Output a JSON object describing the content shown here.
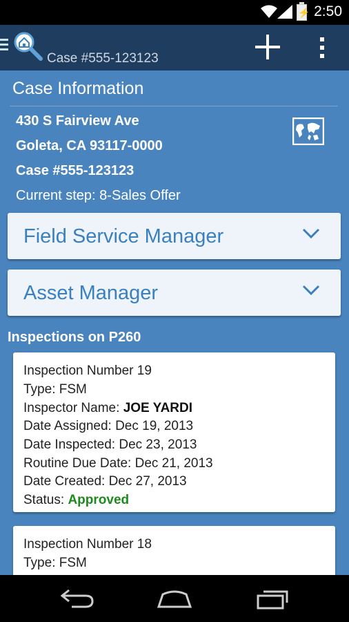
{
  "status_bar": {
    "time": "2:50"
  },
  "action_bar": {
    "title": "Case #555-123123"
  },
  "case_info": {
    "heading": "Case Information",
    "address_line1": "430  S Fairview Ave",
    "address_line2": "Goleta, CA 93117-0000",
    "case_number": "Case #555-123123",
    "current_step": "Current step: 8-Sales Offer"
  },
  "dropdowns": [
    {
      "label": "Field Service Manager"
    },
    {
      "label": "Asset Manager"
    }
  ],
  "inspections": {
    "heading": "Inspections on P260",
    "cards": [
      {
        "number": "Inspection Number 19",
        "type": "Type: FSM",
        "inspector_label": "Inspector Name:",
        "inspector_value": "JOE YARDI",
        "date_assigned": "Date Assigned: Dec 19, 2013",
        "date_inspected": "Date Inspected: Dec 23, 2013",
        "routine_due": "Routine Due Date: Dec 21, 2013",
        "date_created": "Date Created: Dec 27, 2013",
        "status_label": "Status:",
        "status_value": "Approved"
      },
      {
        "number": "Inspection Number 18",
        "type": "Type: FSM"
      }
    ]
  },
  "colors": {
    "action_bar": "#1e3d5f",
    "content_bg": "#4a84bf",
    "dropdown_text": "#3a80c0",
    "approved": "#1e8a1e"
  },
  "icons": {
    "app_logo": "house-magnifier-icon",
    "map": "world-map-icon",
    "add": "plus-icon",
    "overflow": "overflow-menu-icon"
  }
}
